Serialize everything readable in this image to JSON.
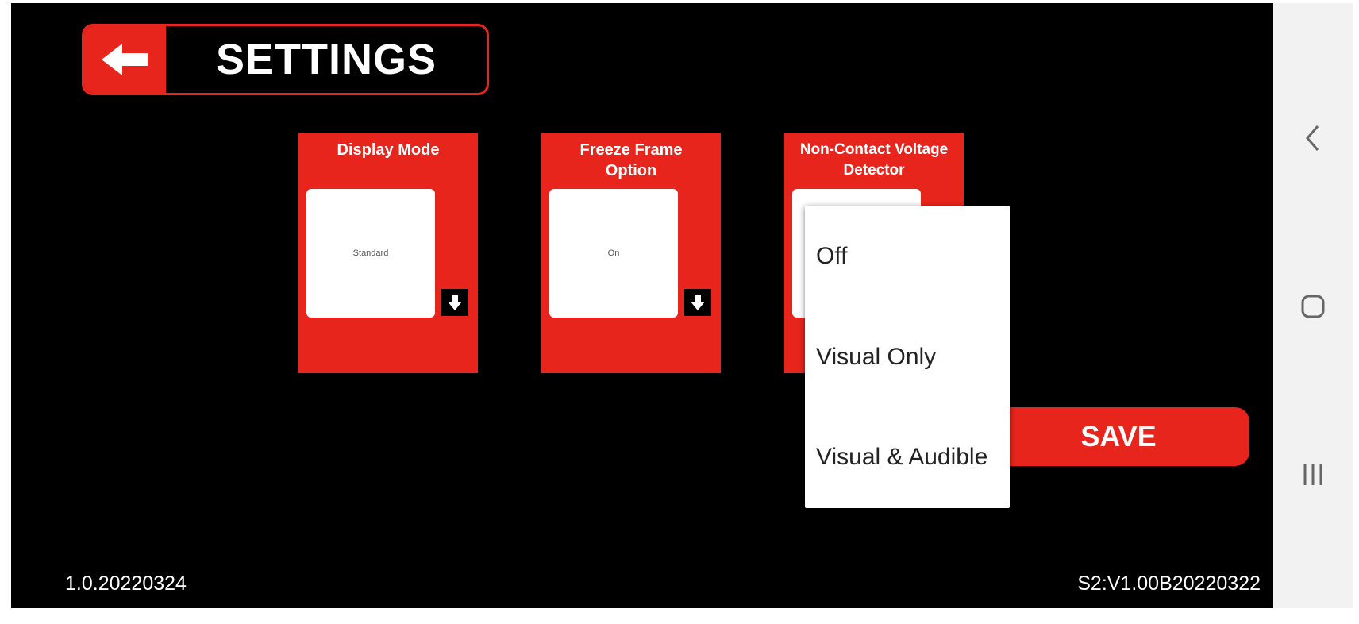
{
  "header": {
    "title": "SETTINGS",
    "back_icon": "arrow-left-icon"
  },
  "cards": [
    {
      "title": "Display Mode",
      "value": "Standard"
    },
    {
      "title": "Freeze Frame Option",
      "value": "On"
    },
    {
      "title": "Non-Contact Voltage Detector",
      "value": ""
    }
  ],
  "dropdown": {
    "options": [
      "Off",
      "Visual Only",
      "Visual & Audible"
    ]
  },
  "save_label": "SAVE",
  "version_left": "1.0.20220324",
  "version_right": "S2:V1.00B20220322",
  "colors": {
    "accent": "#e8251c",
    "background": "#000000",
    "navbar": "#f2f2f2"
  },
  "nav_icons": [
    "back-chevron-icon",
    "home-icon",
    "recent-apps-icon"
  ]
}
